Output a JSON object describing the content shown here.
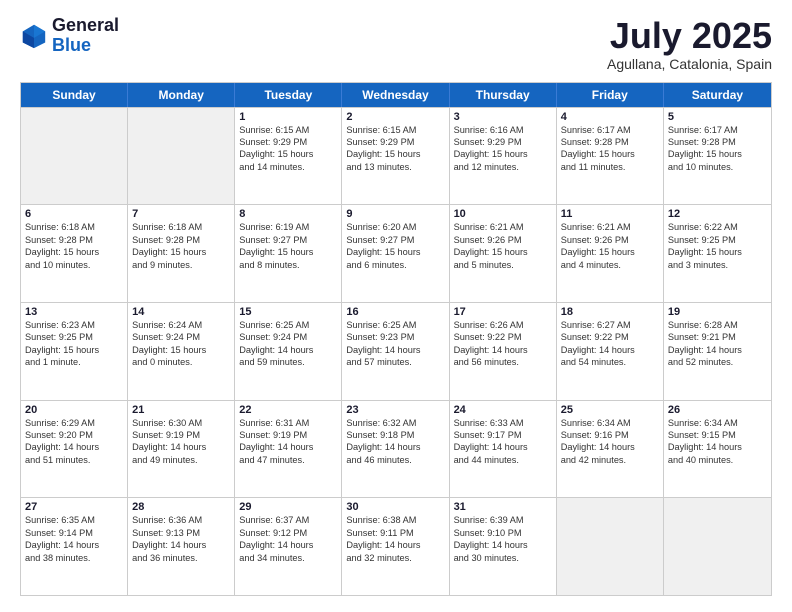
{
  "logo": {
    "general": "General",
    "blue": "Blue"
  },
  "title": "July 2025",
  "subtitle": "Agullana, Catalonia, Spain",
  "headers": [
    "Sunday",
    "Monday",
    "Tuesday",
    "Wednesday",
    "Thursday",
    "Friday",
    "Saturday"
  ],
  "weeks": [
    [
      {
        "day": "",
        "lines": [],
        "shaded": true
      },
      {
        "day": "",
        "lines": [],
        "shaded": true
      },
      {
        "day": "1",
        "lines": [
          "Sunrise: 6:15 AM",
          "Sunset: 9:29 PM",
          "Daylight: 15 hours",
          "and 14 minutes."
        ]
      },
      {
        "day": "2",
        "lines": [
          "Sunrise: 6:15 AM",
          "Sunset: 9:29 PM",
          "Daylight: 15 hours",
          "and 13 minutes."
        ]
      },
      {
        "day": "3",
        "lines": [
          "Sunrise: 6:16 AM",
          "Sunset: 9:29 PM",
          "Daylight: 15 hours",
          "and 12 minutes."
        ]
      },
      {
        "day": "4",
        "lines": [
          "Sunrise: 6:17 AM",
          "Sunset: 9:28 PM",
          "Daylight: 15 hours",
          "and 11 minutes."
        ]
      },
      {
        "day": "5",
        "lines": [
          "Sunrise: 6:17 AM",
          "Sunset: 9:28 PM",
          "Daylight: 15 hours",
          "and 10 minutes."
        ]
      }
    ],
    [
      {
        "day": "6",
        "lines": [
          "Sunrise: 6:18 AM",
          "Sunset: 9:28 PM",
          "Daylight: 15 hours",
          "and 10 minutes."
        ]
      },
      {
        "day": "7",
        "lines": [
          "Sunrise: 6:18 AM",
          "Sunset: 9:28 PM",
          "Daylight: 15 hours",
          "and 9 minutes."
        ]
      },
      {
        "day": "8",
        "lines": [
          "Sunrise: 6:19 AM",
          "Sunset: 9:27 PM",
          "Daylight: 15 hours",
          "and 8 minutes."
        ]
      },
      {
        "day": "9",
        "lines": [
          "Sunrise: 6:20 AM",
          "Sunset: 9:27 PM",
          "Daylight: 15 hours",
          "and 6 minutes."
        ]
      },
      {
        "day": "10",
        "lines": [
          "Sunrise: 6:21 AM",
          "Sunset: 9:26 PM",
          "Daylight: 15 hours",
          "and 5 minutes."
        ]
      },
      {
        "day": "11",
        "lines": [
          "Sunrise: 6:21 AM",
          "Sunset: 9:26 PM",
          "Daylight: 15 hours",
          "and 4 minutes."
        ]
      },
      {
        "day": "12",
        "lines": [
          "Sunrise: 6:22 AM",
          "Sunset: 9:25 PM",
          "Daylight: 15 hours",
          "and 3 minutes."
        ]
      }
    ],
    [
      {
        "day": "13",
        "lines": [
          "Sunrise: 6:23 AM",
          "Sunset: 9:25 PM",
          "Daylight: 15 hours",
          "and 1 minute."
        ]
      },
      {
        "day": "14",
        "lines": [
          "Sunrise: 6:24 AM",
          "Sunset: 9:24 PM",
          "Daylight: 15 hours",
          "and 0 minutes."
        ]
      },
      {
        "day": "15",
        "lines": [
          "Sunrise: 6:25 AM",
          "Sunset: 9:24 PM",
          "Daylight: 14 hours",
          "and 59 minutes."
        ]
      },
      {
        "day": "16",
        "lines": [
          "Sunrise: 6:25 AM",
          "Sunset: 9:23 PM",
          "Daylight: 14 hours",
          "and 57 minutes."
        ]
      },
      {
        "day": "17",
        "lines": [
          "Sunrise: 6:26 AM",
          "Sunset: 9:22 PM",
          "Daylight: 14 hours",
          "and 56 minutes."
        ]
      },
      {
        "day": "18",
        "lines": [
          "Sunrise: 6:27 AM",
          "Sunset: 9:22 PM",
          "Daylight: 14 hours",
          "and 54 minutes."
        ]
      },
      {
        "day": "19",
        "lines": [
          "Sunrise: 6:28 AM",
          "Sunset: 9:21 PM",
          "Daylight: 14 hours",
          "and 52 minutes."
        ]
      }
    ],
    [
      {
        "day": "20",
        "lines": [
          "Sunrise: 6:29 AM",
          "Sunset: 9:20 PM",
          "Daylight: 14 hours",
          "and 51 minutes."
        ]
      },
      {
        "day": "21",
        "lines": [
          "Sunrise: 6:30 AM",
          "Sunset: 9:19 PM",
          "Daylight: 14 hours",
          "and 49 minutes."
        ]
      },
      {
        "day": "22",
        "lines": [
          "Sunrise: 6:31 AM",
          "Sunset: 9:19 PM",
          "Daylight: 14 hours",
          "and 47 minutes."
        ]
      },
      {
        "day": "23",
        "lines": [
          "Sunrise: 6:32 AM",
          "Sunset: 9:18 PM",
          "Daylight: 14 hours",
          "and 46 minutes."
        ]
      },
      {
        "day": "24",
        "lines": [
          "Sunrise: 6:33 AM",
          "Sunset: 9:17 PM",
          "Daylight: 14 hours",
          "and 44 minutes."
        ]
      },
      {
        "day": "25",
        "lines": [
          "Sunrise: 6:34 AM",
          "Sunset: 9:16 PM",
          "Daylight: 14 hours",
          "and 42 minutes."
        ]
      },
      {
        "day": "26",
        "lines": [
          "Sunrise: 6:34 AM",
          "Sunset: 9:15 PM",
          "Daylight: 14 hours",
          "and 40 minutes."
        ]
      }
    ],
    [
      {
        "day": "27",
        "lines": [
          "Sunrise: 6:35 AM",
          "Sunset: 9:14 PM",
          "Daylight: 14 hours",
          "and 38 minutes."
        ]
      },
      {
        "day": "28",
        "lines": [
          "Sunrise: 6:36 AM",
          "Sunset: 9:13 PM",
          "Daylight: 14 hours",
          "and 36 minutes."
        ]
      },
      {
        "day": "29",
        "lines": [
          "Sunrise: 6:37 AM",
          "Sunset: 9:12 PM",
          "Daylight: 14 hours",
          "and 34 minutes."
        ]
      },
      {
        "day": "30",
        "lines": [
          "Sunrise: 6:38 AM",
          "Sunset: 9:11 PM",
          "Daylight: 14 hours",
          "and 32 minutes."
        ]
      },
      {
        "day": "31",
        "lines": [
          "Sunrise: 6:39 AM",
          "Sunset: 9:10 PM",
          "Daylight: 14 hours",
          "and 30 minutes."
        ]
      },
      {
        "day": "",
        "lines": [],
        "shaded": true
      },
      {
        "day": "",
        "lines": [],
        "shaded": true
      }
    ]
  ]
}
